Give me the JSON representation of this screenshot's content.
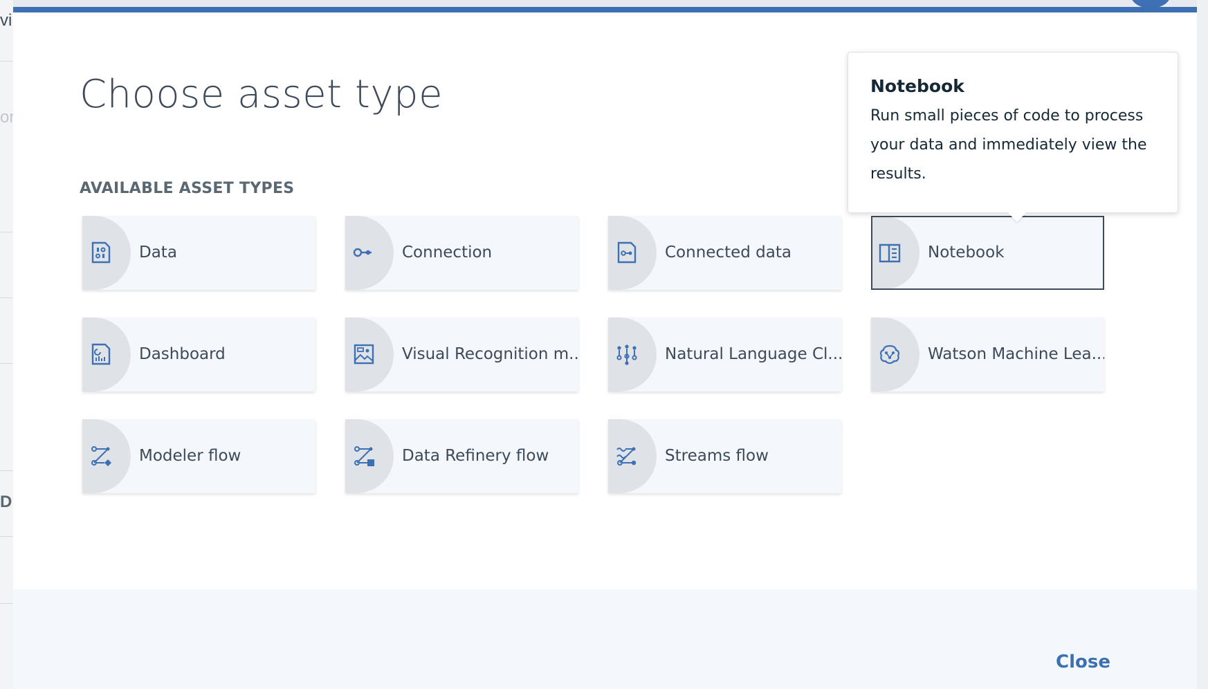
{
  "modal": {
    "title": "Choose asset type",
    "section_heading": "AVAILABLE ASSET TYPES",
    "close_icon": "close-icon",
    "close_label": "Close"
  },
  "tiles": [
    {
      "label": "Data",
      "icon": "data-icon"
    },
    {
      "label": "Connection",
      "icon": "connection-icon"
    },
    {
      "label": "Connected data",
      "icon": "connected-data-icon"
    },
    {
      "label": "Notebook",
      "icon": "notebook-icon",
      "selected": true
    },
    {
      "label": "Dashboard",
      "icon": "dashboard-icon"
    },
    {
      "label": "Visual Recognition m...",
      "icon": "visual-recognition-icon"
    },
    {
      "label": "Natural Language Cl...",
      "icon": "natural-language-classifier-icon"
    },
    {
      "label": "Watson Machine Lea...",
      "icon": "machine-learning-icon"
    },
    {
      "label": "Modeler flow",
      "icon": "modeler-flow-icon"
    },
    {
      "label": "Data Refinery flow",
      "icon": "data-refinery-flow-icon"
    },
    {
      "label": "Streams flow",
      "icon": "streams-flow-icon"
    }
  ],
  "tooltip": {
    "title": "Notebook",
    "body": "Run small pieces of code to process your data and immediately view the results."
  },
  "background": {
    "fragments": [
      "vi",
      "or",
      "D"
    ]
  },
  "colors": {
    "accent": "#3d70b2",
    "text": "#3d4a59",
    "tile_bg": "#f4f7fb",
    "tile_circle": "#dfe3e8"
  }
}
